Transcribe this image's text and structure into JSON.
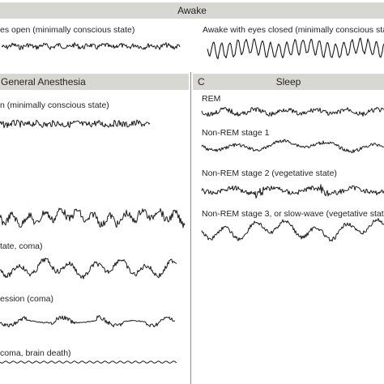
{
  "panels": {
    "awake": {
      "title": "Awake",
      "traces": [
        {
          "label": "es open (minimally conscious state)"
        },
        {
          "label": "Awake with eyes closed (minimally conscious sta"
        }
      ]
    },
    "general_anesthesia": {
      "title": "General Anesthesia",
      "traces": [
        {
          "label": "n (minimally conscious state)"
        },
        {
          "label": ""
        },
        {
          "label": "tate, coma)"
        },
        {
          "label": "ession (coma)"
        },
        {
          "label": "coma, brain death)"
        }
      ]
    },
    "sleep": {
      "letter": "C",
      "title": "Sleep",
      "traces": [
        {
          "label": "REM"
        },
        {
          "label": "Non-REM stage 1"
        },
        {
          "label": "Non-REM stage 2 (vegetative state)"
        },
        {
          "label": "Non-REM stage 3, or slow-wave (vegetative state"
        }
      ]
    }
  },
  "colors": {
    "header_fill": "#d8d8d3",
    "trace": "#1a1a1a",
    "divider": "#8a8a8a"
  }
}
